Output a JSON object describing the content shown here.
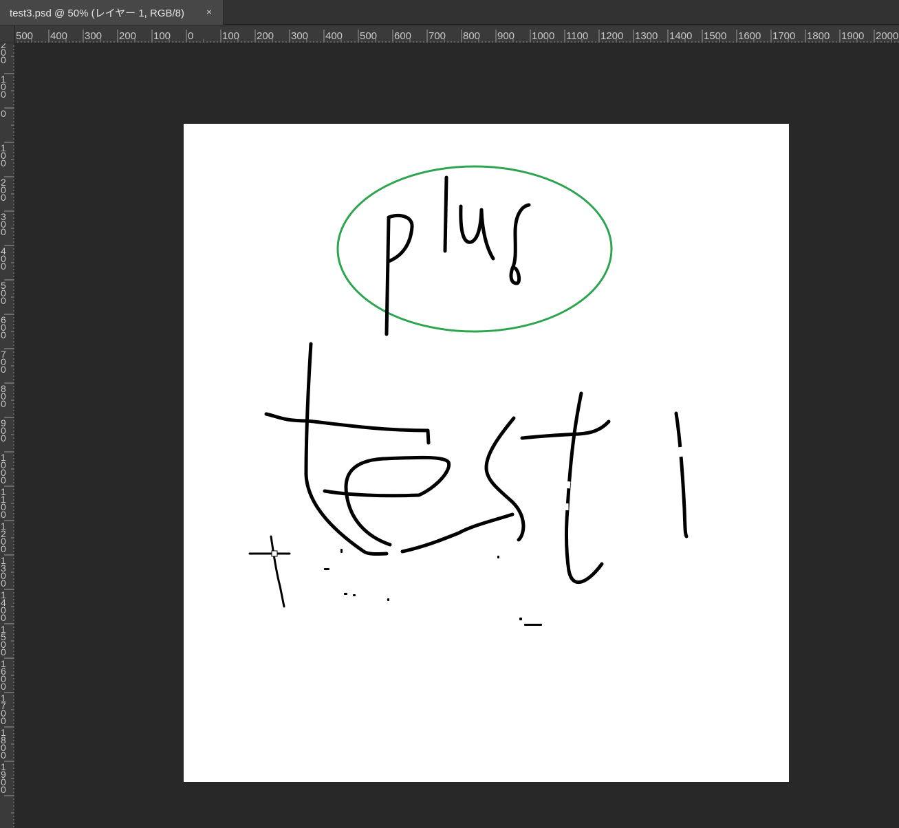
{
  "window": {
    "tab_title": "test3.psd @ 50% (レイヤー 1, RGB/8)",
    "close_symbol": "×"
  },
  "ruler": {
    "horizontal_labels": [
      "500",
      "400",
      "300",
      "200",
      "100",
      "0",
      "100",
      "200",
      "300",
      "400",
      "500",
      "600",
      "700",
      "800",
      "900",
      "1000",
      "1100",
      "1200",
      "1300",
      "1400",
      "1500",
      "1600",
      "1700",
      "1800",
      "1900",
      "2000"
    ],
    "vertical_labels": [
      "0",
      "200",
      "100",
      "0",
      "100",
      "200",
      "300",
      "400",
      "500",
      "600",
      "700",
      "800",
      "900",
      "1000",
      "1100",
      "1200",
      "1300",
      "1400",
      "1500",
      "1600",
      "1700",
      "1800",
      "1900"
    ],
    "text_color": "#c8c8c8",
    "background": "#3a3a3a"
  },
  "document": {
    "zoom": "50%",
    "layer": "レイヤー 1",
    "mode": "RGB/8",
    "background_color": "#ffffff",
    "workspace_color": "#282828"
  },
  "drawing": {
    "ink_color": "#000000",
    "ellipse_color": "#2da44e",
    "words": [
      "plus",
      "test",
      "1"
    ]
  }
}
